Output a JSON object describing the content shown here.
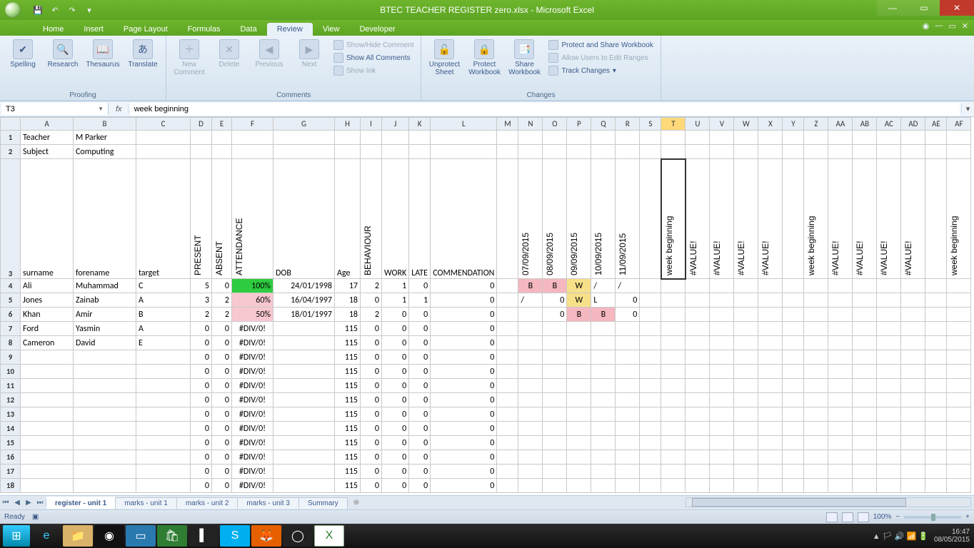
{
  "window": {
    "title": "BTEC TEACHER REGISTER zero.xlsx - Microsoft Excel",
    "status": "Ready",
    "zoom": "100%",
    "clock_time": "16:47",
    "clock_date": "08/05/2015"
  },
  "tabs": {
    "items": [
      "Home",
      "Insert",
      "Page Layout",
      "Formulas",
      "Data",
      "Review",
      "View",
      "Developer"
    ],
    "active": "Review"
  },
  "ribbon": {
    "proofing": {
      "label": "Proofing",
      "spelling": "Spelling",
      "research": "Research",
      "thesaurus": "Thesaurus",
      "translate": "Translate"
    },
    "comments": {
      "label": "Comments",
      "new": "New\nComment",
      "delete": "Delete",
      "previous": "Previous",
      "next": "Next",
      "showhide": "Show/Hide Comment",
      "showall": "Show All Comments",
      "showink": "Show Ink"
    },
    "changes": {
      "label": "Changes",
      "unprotect": "Unprotect\nSheet",
      "protectwb": "Protect\nWorkbook",
      "sharewb": "Share\nWorkbook",
      "protectshare": "Protect and Share Workbook",
      "allowranges": "Allow Users to Edit Ranges",
      "track": "Track Changes"
    }
  },
  "formula": {
    "cellref": "T3",
    "value": "week beginning"
  },
  "columns": [
    "A",
    "B",
    "C",
    "D",
    "E",
    "F",
    "G",
    "H",
    "I",
    "J",
    "K",
    "L",
    "M",
    "N",
    "O",
    "P",
    "Q",
    "R",
    "S",
    "T",
    "U",
    "V",
    "W",
    "X",
    "Y",
    "Z",
    "AA",
    "AB",
    "AC",
    "AD",
    "AE",
    "AF"
  ],
  "header_row1": {
    "A": "Teacher",
    "B": "M Parker"
  },
  "header_row2": {
    "A": "Subject",
    "B": "Computing"
  },
  "row3_labels": {
    "A": "surname",
    "B": "forename",
    "C": "target",
    "D": "PRESENT",
    "E": "ABSENT",
    "F": "ATTENDANCE",
    "G": "DOB",
    "H": "Age",
    "I": "BEHAVIOUR",
    "J": "WORK",
    "K": "LATE",
    "L": "COMMENDATION",
    "M": "",
    "N": "07/09/2015",
    "O": "08/09/2015",
    "P": "09/09/2015",
    "Q": "10/09/2015",
    "R": "11/09/2015",
    "S": "",
    "T": "week beginning",
    "U": "#VALUE!",
    "V": "#VALUE!",
    "W": "#VALUE!",
    "X": "#VALUE!",
    "Y": "",
    "Z": "week beginning",
    "AA": "#VALUE!",
    "AB": "#VALUE!",
    "AC": "#VALUE!",
    "AD": "#VALUE!",
    "AE": "",
    "AF": "week beginning"
  },
  "rows": [
    {
      "n": 4,
      "A": "Ali",
      "B": "Muhammad",
      "C": "C",
      "D": "5",
      "E": "0",
      "F": "100%",
      "Fclass": "att-green",
      "G": "24/01/1998",
      "H": "17",
      "I": "2",
      "J": "1",
      "K": "0",
      "L": "0",
      "N": "B",
      "Nclass": "mark-b",
      "O": "B",
      "Oclass": "mark-b",
      "P": "W",
      "Pclass": "mark-w",
      "Q": "/",
      "R": "/"
    },
    {
      "n": 5,
      "A": "Jones",
      "B": "Zainab",
      "C": "A",
      "D": "3",
      "E": "2",
      "F": "60%",
      "Fclass": "att-pink",
      "G": "16/04/1997",
      "H": "18",
      "I": "0",
      "J": "1",
      "K": "1",
      "L": "0",
      "N": "/",
      "O": "0",
      "Oclass": "num",
      "P": "W",
      "Pclass": "mark-w",
      "Q": "L",
      "R": "0",
      "Rclass": "num"
    },
    {
      "n": 6,
      "A": "Khan",
      "B": "Amir",
      "C": "B",
      "D": "2",
      "E": "2",
      "F": "50%",
      "Fclass": "att-pink",
      "G": "18/01/1997",
      "H": "18",
      "I": "2",
      "J": "0",
      "K": "0",
      "L": "0",
      "N": "",
      "O": "0",
      "Oclass": "num",
      "P": "B",
      "Pclass": "mark-b",
      "Q": "B",
      "Qclass": "mark-b",
      "R": "0",
      "Rclass": "num"
    },
    {
      "n": 7,
      "A": "Ford",
      "B": "Yasmin",
      "C": "A",
      "D": "0",
      "E": "0",
      "F": "#DIV/0!",
      "G": "",
      "H": "115",
      "I": "0",
      "J": "0",
      "K": "0",
      "L": "0"
    },
    {
      "n": 8,
      "A": "Cameron",
      "B": "David",
      "C": "E",
      "D": "0",
      "E": "0",
      "F": "#DIV/0!",
      "G": "",
      "H": "115",
      "I": "0",
      "J": "0",
      "K": "0",
      "L": "0"
    },
    {
      "n": 9,
      "D": "0",
      "E": "0",
      "F": "#DIV/0!",
      "H": "115",
      "I": "0",
      "J": "0",
      "K": "0",
      "L": "0"
    },
    {
      "n": 10,
      "D": "0",
      "E": "0",
      "F": "#DIV/0!",
      "H": "115",
      "I": "0",
      "J": "0",
      "K": "0",
      "L": "0"
    },
    {
      "n": 11,
      "D": "0",
      "E": "0",
      "F": "#DIV/0!",
      "H": "115",
      "I": "0",
      "J": "0",
      "K": "0",
      "L": "0"
    },
    {
      "n": 12,
      "D": "0",
      "E": "0",
      "F": "#DIV/0!",
      "H": "115",
      "I": "0",
      "J": "0",
      "K": "0",
      "L": "0"
    },
    {
      "n": 13,
      "D": "0",
      "E": "0",
      "F": "#DIV/0!",
      "H": "115",
      "I": "0",
      "J": "0",
      "K": "0",
      "L": "0"
    },
    {
      "n": 14,
      "D": "0",
      "E": "0",
      "F": "#DIV/0!",
      "H": "115",
      "I": "0",
      "J": "0",
      "K": "0",
      "L": "0"
    },
    {
      "n": 15,
      "D": "0",
      "E": "0",
      "F": "#DIV/0!",
      "H": "115",
      "I": "0",
      "J": "0",
      "K": "0",
      "L": "0"
    },
    {
      "n": 16,
      "D": "0",
      "E": "0",
      "F": "#DIV/0!",
      "H": "115",
      "I": "0",
      "J": "0",
      "K": "0",
      "L": "0"
    },
    {
      "n": 17,
      "D": "0",
      "E": "0",
      "F": "#DIV/0!",
      "H": "115",
      "I": "0",
      "J": "0",
      "K": "0",
      "L": "0"
    },
    {
      "n": 18,
      "D": "0",
      "E": "0",
      "F": "#DIV/0!",
      "H": "115",
      "I": "0",
      "J": "0",
      "K": "0",
      "L": "0"
    }
  ],
  "sheet_tabs": {
    "items": [
      "register - unit 1",
      "marks - unit 1",
      "marks - unit 2",
      "marks - unit 3",
      "Summary"
    ],
    "active": 0
  }
}
